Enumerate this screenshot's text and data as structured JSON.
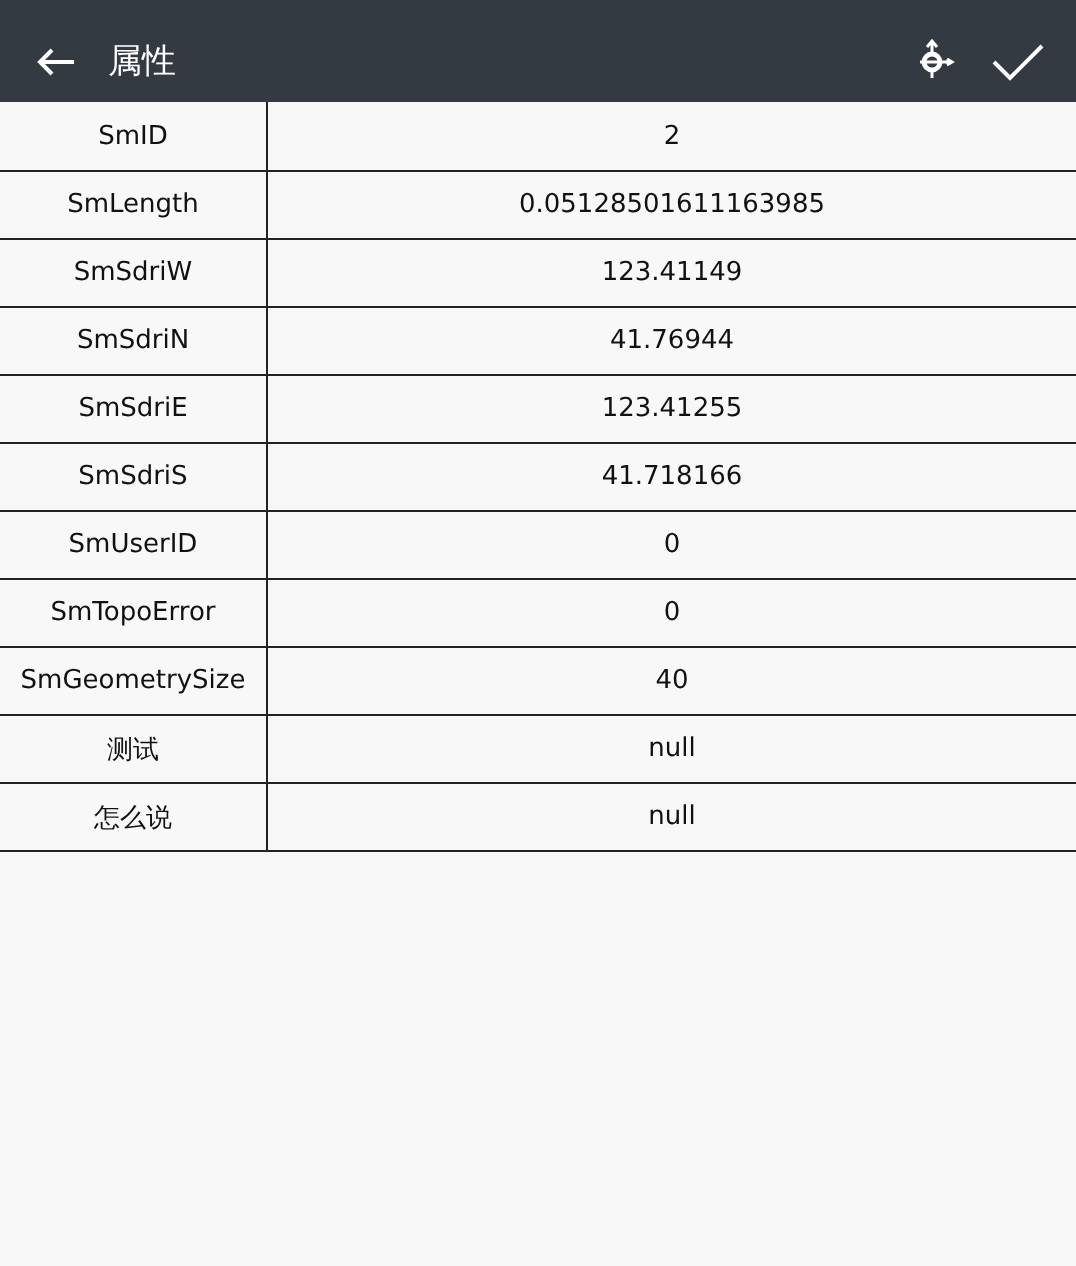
{
  "toolbar": {
    "title": "属性"
  },
  "rows": [
    {
      "field": "SmID",
      "value": "2"
    },
    {
      "field": "SmLength",
      "value": "0.05128501611163985"
    },
    {
      "field": "SmSdriW",
      "value": "123.41149"
    },
    {
      "field": "SmSdriN",
      "value": "41.76944"
    },
    {
      "field": "SmSdriE",
      "value": "123.41255"
    },
    {
      "field": "SmSdriS",
      "value": "41.718166"
    },
    {
      "field": "SmUserID",
      "value": "0"
    },
    {
      "field": "SmTopoError",
      "value": "0"
    },
    {
      "field": "SmGeometrySize",
      "value": "40"
    },
    {
      "field": "测试",
      "value": "null"
    },
    {
      "field": "怎么说",
      "value": "null"
    }
  ]
}
